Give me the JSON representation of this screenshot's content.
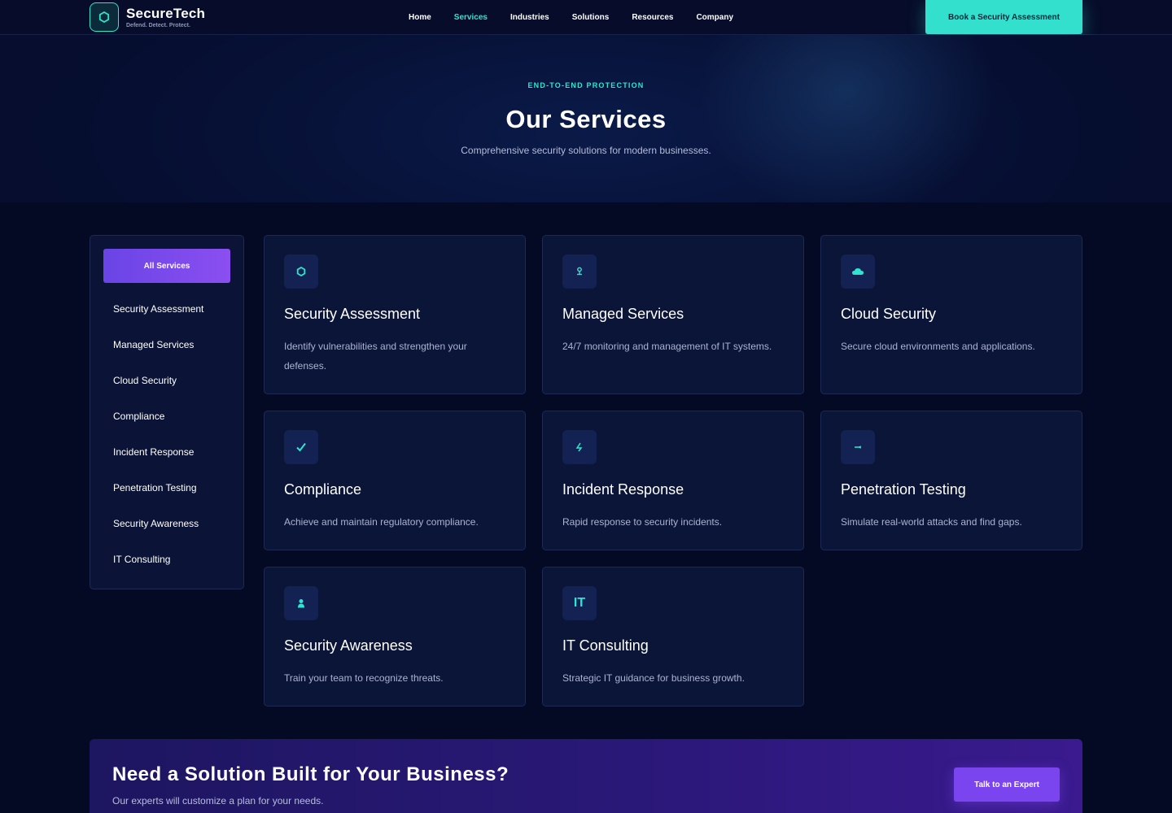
{
  "brand": {
    "name": "SecureTech",
    "tagline": "Defend. Detect. Protect.",
    "logo_icon": "hexagon-icon",
    "accent": "#2ee6cf"
  },
  "nav": {
    "items": [
      {
        "label": "Home",
        "active": false
      },
      {
        "label": "Services",
        "active": true
      },
      {
        "label": "Industries",
        "active": false
      },
      {
        "label": "Solutions",
        "active": false
      },
      {
        "label": "Resources",
        "active": false
      },
      {
        "label": "Company",
        "active": false
      }
    ],
    "cta_label": "Book a Security Assessment"
  },
  "hero": {
    "eyebrow": "END-TO-END PROTECTION",
    "title": "Our Services",
    "subtitle": "Comprehensive security solutions for modern businesses."
  },
  "sidebar": {
    "active_label": "All Services",
    "items": [
      {
        "label": "Security Assessment"
      },
      {
        "label": "Managed Services"
      },
      {
        "label": "Cloud Security"
      },
      {
        "label": "Compliance"
      },
      {
        "label": "Incident Response"
      },
      {
        "label": "Penetration Testing"
      },
      {
        "label": "Security Awareness"
      },
      {
        "label": "IT Consulting"
      }
    ]
  },
  "services": [
    {
      "title": "Security Assessment",
      "description": "Identify vulnerabilities and strengthen your defenses.",
      "icon": "hexagon-icon"
    },
    {
      "title": "Managed Services",
      "description": "24/7 monitoring and management of IT systems.",
      "icon": "network-icon"
    },
    {
      "title": "Cloud Security",
      "description": "Secure cloud environments and applications.",
      "icon": "cloud-icon"
    },
    {
      "title": "Compliance",
      "description": "Achieve and maintain regulatory compliance.",
      "icon": "checkmark-icon"
    },
    {
      "title": "Incident Response",
      "description": "Rapid response to security incidents.",
      "icon": "lightning-icon"
    },
    {
      "title": "Penetration Testing",
      "description": "Simulate real-world attacks and find gaps.",
      "icon": "target-icon"
    },
    {
      "title": "Security Awareness",
      "description": "Train your team to recognize threats.",
      "icon": "person-icon"
    },
    {
      "title": "IT Consulting",
      "description": "Strategic IT guidance for business growth.",
      "icon": "it-text-icon",
      "icon_text": "IT"
    }
  ],
  "cta": {
    "title": "Need a Solution Built for Your Business?",
    "subtitle": "Our experts will customize a plan for your needs.",
    "button_label": "Talk to an Expert"
  }
}
